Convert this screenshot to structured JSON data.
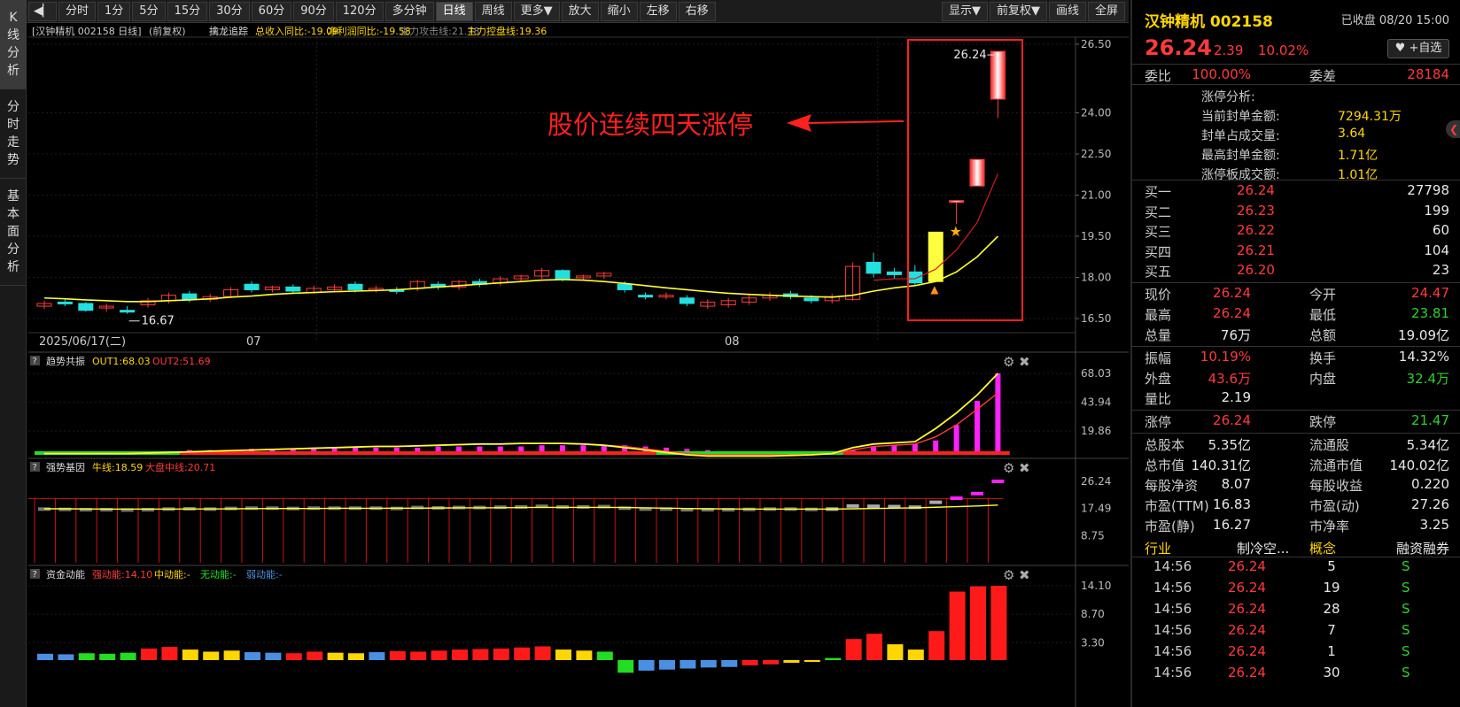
{
  "vtabs": [
    {
      "label": "K\n线\n分\n析"
    },
    {
      "label": "分\n时\n走\n势"
    },
    {
      "label": "基\n本\n面\n分\n析"
    }
  ],
  "toolbar": {
    "left_buttons": [
      "分时",
      "1分",
      "5分",
      "15分",
      "30分",
      "60分",
      "90分",
      "120分",
      "多分钟",
      "日线",
      "周线",
      "更多▼",
      "放大",
      "缩小",
      "左移",
      "右移"
    ],
    "active": "日线",
    "right_buttons": [
      "显示▼",
      "前复权▼",
      "画线",
      "全屏"
    ]
  },
  "main_header": {
    "stock": "[汉钟精机 002158 日线]",
    "adj": "(前复权)",
    "indicator": "擒龙追踪",
    "ind_items": [
      {
        "text": "总收入同比:-19.09",
        "color": "#ffd700"
      },
      {
        "text": "净利润同比:-19.58",
        "color": "#ffd700"
      },
      {
        "text": "主力攻击线:21.78",
        "color": "#888888"
      },
      {
        "text": "主力控盘线:19.36",
        "color": "#ffd700"
      }
    ]
  },
  "annotation": {
    "text": "股价连续四天涨停"
  },
  "panels": {
    "trend": {
      "name": "趋势共振",
      "out1": "OUT1:68.03",
      "out2": "OUT2:51.69"
    },
    "strong": {
      "name": "强势基因",
      "bull": "牛线:18.59",
      "mid": "大盘中线:20.71"
    },
    "fund": {
      "name": "资金动能",
      "strong": "强动能:14.10",
      "mid": "中动能:-",
      "none": "无动能:-",
      "weak": "弱动能:-"
    }
  },
  "panel_help": "?",
  "chart_data": {
    "type": "candlestick",
    "x_labels": [
      "2025/06/17(二)",
      "07",
      "08"
    ],
    "price_ticks": [
      "26.50",
      "24.00",
      "22.50",
      "21.00",
      "19.50",
      "18.00",
      "16.50"
    ],
    "trend_ticks": [
      "68.03",
      "43.94",
      "19.86"
    ],
    "strong_ticks": [
      "26.24",
      "17.49",
      "8.75"
    ],
    "fund_ticks": [
      "14.10",
      "8.70",
      "3.30"
    ],
    "high_label": "26.24",
    "low_label": "16.67",
    "yrange": [
      16.5,
      26.5
    ],
    "candles": [
      [
        16.95,
        17.05,
        16.85,
        17.15
      ],
      [
        17.1,
        17.05,
        16.95,
        17.2
      ],
      [
        17.05,
        16.8,
        16.75,
        17.1
      ],
      [
        16.9,
        16.95,
        16.75,
        17.05
      ],
      [
        16.8,
        16.75,
        16.67,
        16.95
      ],
      [
        17.0,
        17.15,
        16.9,
        17.25
      ],
      [
        17.15,
        17.35,
        17.05,
        17.45
      ],
      [
        17.4,
        17.2,
        17.1,
        17.5
      ],
      [
        17.2,
        17.3,
        17.1,
        17.4
      ],
      [
        17.3,
        17.55,
        17.25,
        17.65
      ],
      [
        17.75,
        17.55,
        17.45,
        17.85
      ],
      [
        17.55,
        17.65,
        17.45,
        17.7
      ],
      [
        17.65,
        17.5,
        17.4,
        17.75
      ],
      [
        17.45,
        17.6,
        17.4,
        17.7
      ],
      [
        17.55,
        17.65,
        17.45,
        17.75
      ],
      [
        17.75,
        17.55,
        17.45,
        17.85
      ],
      [
        17.55,
        17.6,
        17.45,
        17.7
      ],
      [
        17.55,
        17.5,
        17.4,
        17.65
      ],
      [
        17.6,
        17.85,
        17.5,
        17.9
      ],
      [
        17.75,
        17.65,
        17.55,
        17.85
      ],
      [
        17.65,
        17.85,
        17.55,
        17.9
      ],
      [
        17.85,
        17.75,
        17.65,
        17.95
      ],
      [
        17.8,
        17.95,
        17.7,
        18.05
      ],
      [
        17.95,
        18.05,
        17.85,
        18.1
      ],
      [
        18.05,
        18.25,
        17.95,
        18.35
      ],
      [
        18.25,
        17.95,
        17.85,
        18.3
      ],
      [
        18.0,
        18.05,
        17.9,
        18.1
      ],
      [
        18.05,
        18.15,
        17.95,
        18.2
      ],
      [
        17.75,
        17.55,
        17.45,
        17.85
      ],
      [
        17.35,
        17.3,
        17.2,
        17.45
      ],
      [
        17.3,
        17.35,
        17.2,
        17.45
      ],
      [
        17.25,
        17.05,
        16.95,
        17.35
      ],
      [
        16.95,
        17.1,
        16.85,
        17.2
      ],
      [
        17.0,
        17.15,
        16.9,
        17.25
      ],
      [
        17.1,
        17.25,
        17.0,
        17.35
      ],
      [
        17.25,
        17.35,
        17.15,
        17.45
      ],
      [
        17.4,
        17.3,
        17.2,
        17.5
      ],
      [
        17.25,
        17.15,
        17.05,
        17.35
      ],
      [
        17.15,
        17.3,
        17.05,
        17.4
      ],
      [
        17.2,
        18.4,
        17.15,
        18.55
      ],
      [
        18.55,
        18.15,
        18.0,
        18.9
      ],
      [
        18.2,
        18.1,
        17.95,
        18.35
      ],
      [
        18.2,
        17.8,
        17.7,
        18.45
      ],
      [
        17.85,
        19.65,
        17.85,
        19.65
      ],
      [
        20.8,
        20.8,
        19.95,
        20.8
      ],
      [
        22.3,
        22.3,
        22.3,
        22.3
      ],
      [
        24.5,
        26.24,
        23.81,
        26.24
      ]
    ],
    "line_yellow": [
      17.25,
      17.22,
      17.18,
      17.15,
      17.12,
      17.12,
      17.15,
      17.18,
      17.22,
      17.28,
      17.32,
      17.38,
      17.42,
      17.45,
      17.48,
      17.5,
      17.52,
      17.55,
      17.6,
      17.65,
      17.7,
      17.75,
      17.8,
      17.85,
      17.9,
      17.92,
      17.9,
      17.85,
      17.78,
      17.7,
      17.62,
      17.55,
      17.48,
      17.42,
      17.38,
      17.35,
      17.32,
      17.3,
      17.28,
      17.35,
      17.5,
      17.62,
      17.7,
      17.85,
      18.2,
      18.75,
      19.5
    ],
    "line_red": [
      null,
      null,
      null,
      null,
      null,
      null,
      null,
      null,
      null,
      null,
      null,
      null,
      null,
      null,
      null,
      null,
      null,
      null,
      null,
      null,
      null,
      null,
      null,
      null,
      null,
      null,
      null,
      null,
      null,
      null,
      null,
      null,
      null,
      null,
      null,
      null,
      null,
      null,
      null,
      null,
      17.9,
      17.95,
      17.95,
      18.3,
      19.0,
      20.0,
      21.78
    ],
    "trend_bars": [
      2,
      2,
      2,
      2,
      2,
      3,
      3,
      4,
      4,
      4,
      5,
      5,
      5,
      6,
      6,
      6,
      6,
      6,
      6,
      7,
      7,
      7,
      7,
      7,
      8,
      8,
      8,
      8,
      8,
      7,
      6,
      5,
      4,
      3,
      2,
      2,
      2,
      2,
      2,
      4,
      7,
      8,
      9,
      12,
      25,
      45,
      68.03
    ],
    "trend_line1": [
      1,
      1,
      1,
      1,
      1,
      1.5,
      2,
      2.5,
      3,
      3.5,
      4,
      4.5,
      5,
      5.5,
      6,
      6.5,
      7,
      7,
      7.5,
      8,
      8.5,
      9,
      9,
      9.5,
      9.5,
      9.5,
      9,
      8,
      6,
      4,
      2,
      0,
      -1,
      -1,
      -1,
      -1,
      -0.5,
      0,
      1,
      6,
      9,
      10,
      11,
      22,
      35,
      50,
      68.03
    ],
    "trend_line2": [
      1,
      1,
      1,
      1,
      1,
      1.5,
      2,
      2.5,
      3,
      3.5,
      4,
      4.5,
      5,
      5.5,
      6,
      6.5,
      7,
      7,
      7.5,
      8,
      8.5,
      9,
      9,
      9.5,
      9.5,
      9.5,
      9,
      8,
      7,
      5,
      3,
      1,
      0,
      0,
      0,
      0,
      0,
      0.5,
      1,
      4,
      7,
      8,
      9,
      15,
      25,
      38,
      51.69
    ],
    "trend_green": [
      1,
      1,
      1,
      1,
      1,
      1,
      1,
      0,
      0,
      0,
      0,
      0,
      0,
      0,
      0,
      0,
      0,
      0,
      0,
      0,
      0,
      0,
      0,
      0,
      0,
      0,
      0,
      0,
      0,
      0,
      1,
      1,
      1,
      1,
      1,
      1,
      1,
      1,
      1,
      0,
      0,
      0,
      0,
      0,
      0,
      0,
      0
    ],
    "strong_bars": [
      17.3,
      17.2,
      17.1,
      17.1,
      17.0,
      17.1,
      17.3,
      17.4,
      17.3,
      17.5,
      17.6,
      17.6,
      17.5,
      17.6,
      17.6,
      17.6,
      17.6,
      17.5,
      17.8,
      17.7,
      17.8,
      17.8,
      17.9,
      18.0,
      18.2,
      18.0,
      18.0,
      18.1,
      17.6,
      17.3,
      17.3,
      17.1,
      17.1,
      17.1,
      17.2,
      17.3,
      17.3,
      17.2,
      17.3,
      18.3,
      18.2,
      18.1,
      17.9,
      19.5,
      20.8,
      22.3,
      26.24
    ],
    "strong_line_red": 20.71,
    "strong_line_yellow": [
      17.4,
      17.4,
      17.35,
      17.3,
      17.3,
      17.3,
      17.3,
      17.35,
      17.35,
      17.4,
      17.45,
      17.5,
      17.5,
      17.5,
      17.55,
      17.55,
      17.55,
      17.6,
      17.6,
      17.65,
      17.7,
      17.7,
      17.75,
      17.8,
      17.85,
      17.85,
      17.85,
      17.85,
      17.8,
      17.7,
      17.6,
      17.5,
      17.4,
      17.35,
      17.3,
      17.3,
      17.3,
      17.3,
      17.3,
      17.4,
      17.5,
      17.6,
      17.7,
      17.9,
      18.1,
      18.3,
      18.59
    ],
    "fund_bars": [
      1.2,
      1.1,
      1.3,
      1.2,
      1.4,
      2.2,
      2.5,
      2.0,
      1.6,
      1.8,
      1.5,
      1.4,
      1.3,
      1.6,
      1.4,
      1.3,
      1.5,
      1.7,
      1.6,
      1.8,
      2.0,
      2.1,
      2.2,
      2.4,
      2.6,
      2.0,
      1.8,
      1.6,
      -2.4,
      -2.0,
      -1.8,
      -1.6,
      -1.4,
      -1.3,
      -1.0,
      -0.8,
      -0.5,
      -0.3,
      0.4,
      4.0,
      5.0,
      3.0,
      2.0,
      5.5,
      13.0,
      14.0,
      14.1
    ],
    "fund_colors": [
      "#4a90e2",
      "#4a90e2",
      "#22dd22",
      "#22dd22",
      "#22dd22",
      "#ff1a1a",
      "#ff1a1a",
      "#ffd700",
      "#ffd700",
      "#ffd700",
      "#4a90e2",
      "#4a90e2",
      "#ff1a1a",
      "#ff1a1a",
      "#ffd700",
      "#ffd700",
      "#4a90e2",
      "#ff1a1a",
      "#ff1a1a",
      "#ff1a1a",
      "#ff1a1a",
      "#ff1a1a",
      "#ff1a1a",
      "#ff1a1a",
      "#ff1a1a",
      "#ffd700",
      "#ffd700",
      "#22dd22",
      "#22dd22",
      "#4a90e2",
      "#4a90e2",
      "#4a90e2",
      "#4a90e2",
      "#4a90e2",
      "#ff1a1a",
      "#ff1a1a",
      "#ffd700",
      "#ffd700",
      "#22dd22",
      "#ff1a1a",
      "#ff1a1a",
      "#ffd700",
      "#ffd700",
      "#ff1a1a",
      "#ff1a1a",
      "#ff1a1a",
      "#ff1a1a"
    ]
  },
  "right": {
    "name": "汉钟精机 002158",
    "status": "已收盘 08/20 15:00",
    "price": "26.24",
    "change": "2.39",
    "pct": "10.02%",
    "fav": "♥ +自选",
    "weibi_label": "委比",
    "weibi": "100.00%",
    "weicha_label": "委差",
    "weicha": "28184",
    "zt_title": "涨停分析:",
    "zt": [
      {
        "label": "当前封单金额:",
        "value": "7294.31万"
      },
      {
        "label": "封单占成交量:",
        "value": "3.64"
      },
      {
        "label": "最高封单金额:",
        "value": "1.71亿"
      },
      {
        "label": "涨停板成交额:",
        "value": "1.01亿"
      }
    ],
    "orderbook": [
      {
        "label": "买一",
        "price": "26.24",
        "qty": "27798"
      },
      {
        "label": "买二",
        "price": "26.23",
        "qty": "199"
      },
      {
        "label": "买三",
        "price": "26.22",
        "qty": "60"
      },
      {
        "label": "买四",
        "price": "26.21",
        "qty": "104"
      },
      {
        "label": "买五",
        "price": "26.20",
        "qty": "23"
      }
    ],
    "quote": [
      {
        "l1": "现价",
        "v1": "26.24",
        "c1": "red",
        "l2": "今开",
        "v2": "24.47",
        "c2": "red"
      },
      {
        "l1": "最高",
        "v1": "26.24",
        "c1": "red",
        "l2": "最低",
        "v2": "23.81",
        "c2": "green"
      },
      {
        "l1": "总量",
        "v1": "76万",
        "c1": "white",
        "l2": "总额",
        "v2": "19.09亿",
        "c2": "white"
      }
    ],
    "stats1": [
      {
        "l1": "振幅",
        "v1": "10.19%",
        "c1": "red",
        "l2": "换手",
        "v2": "14.32%",
        "c2": "white"
      },
      {
        "l1": "外盘",
        "v1": "43.6万",
        "c1": "red",
        "l2": "内盘",
        "v2": "32.4万",
        "c2": "green"
      },
      {
        "l1": "量比",
        "v1": "2.19",
        "c1": "white",
        "l2": "",
        "v2": "",
        "c2": "white"
      }
    ],
    "limit": {
      "l1": "涨停",
      "v1": "26.24",
      "l2": "跌停",
      "v2": "21.47"
    },
    "fund": [
      {
        "l1": "总股本",
        "v1": "5.35亿",
        "l2": "流通股",
        "v2": "5.34亿"
      },
      {
        "l1": "总市值",
        "v1": "140.31亿",
        "l2": "流通市值",
        "v2": "140.02亿"
      },
      {
        "l1": "每股净资",
        "v1": "8.07",
        "l2": "每股收益",
        "v2": "0.220"
      },
      {
        "l1": "市盈(TTM)",
        "v1": "16.83",
        "l2": "市盈(动)",
        "v2": "27.26"
      },
      {
        "l1": "市盈(静)",
        "v1": "16.27",
        "l2": "市净率",
        "v2": "3.25"
      }
    ],
    "tabs": {
      "industry": "行业",
      "industry_val": "制冷空...",
      "concept": "概念",
      "margin": "融资融券"
    },
    "ticks": [
      {
        "t": "14:56",
        "p": "26.24",
        "v": "5",
        "s": "S"
      },
      {
        "t": "14:56",
        "p": "26.24",
        "v": "19",
        "s": "S"
      },
      {
        "t": "14:56",
        "p": "26.24",
        "v": "28",
        "s": "S"
      },
      {
        "t": "14:56",
        "p": "26.24",
        "v": "7",
        "s": "S"
      },
      {
        "t": "14:56",
        "p": "26.24",
        "v": "1",
        "s": "S"
      },
      {
        "t": "14:56",
        "p": "26.24",
        "v": "30",
        "s": "S"
      }
    ]
  }
}
